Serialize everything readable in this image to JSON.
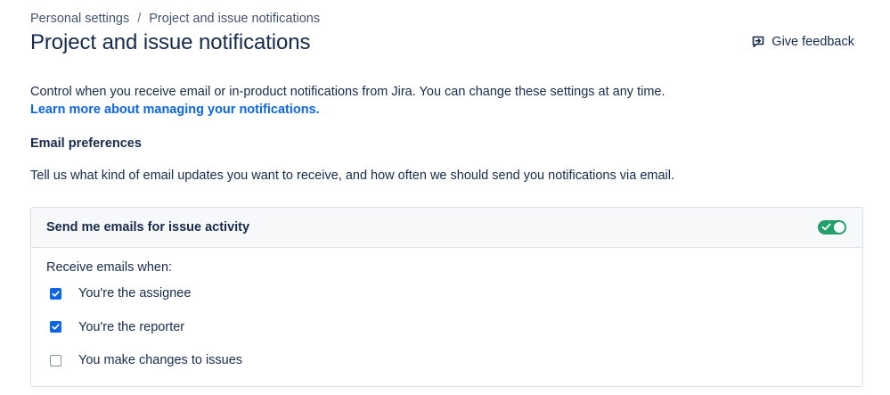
{
  "breadcrumb": {
    "items": [
      "Personal settings",
      "Project and issue notifications"
    ],
    "separator": "/"
  },
  "page_title": "Project and issue notifications",
  "feedback": {
    "label": "Give feedback",
    "icon": "feedback-icon"
  },
  "description": {
    "text": "Control when you receive email or in-product notifications from Jira. You can change these settings at any time.",
    "link_text": "Learn more about managing your notifications."
  },
  "email_preferences": {
    "heading": "Email preferences",
    "description": "Tell us what kind of email updates you want to receive, and how often we should send you notifications via email.",
    "card": {
      "title": "Send me emails for issue activity",
      "toggle_on": true,
      "receive_label": "Receive emails when:",
      "options": [
        {
          "label": "You're the assignee",
          "checked": true
        },
        {
          "label": "You're the reporter",
          "checked": true
        },
        {
          "label": "You make changes to issues",
          "checked": false
        }
      ]
    }
  },
  "colors": {
    "link": "#0c66e4",
    "toggle_on": "#22a06b",
    "checkbox_checked": "#0c66e4",
    "text": "#172b4d"
  }
}
